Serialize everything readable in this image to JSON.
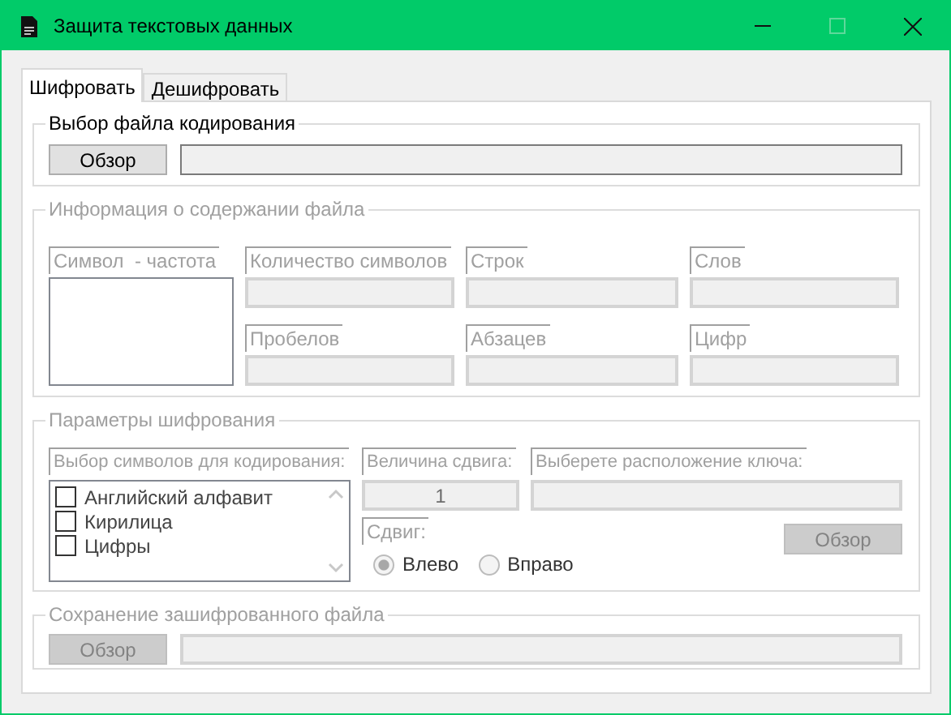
{
  "window": {
    "title": "Защита текстовых данных"
  },
  "tabs": [
    {
      "label": "Шифровать",
      "selected": true
    },
    {
      "label": "Дешифровать",
      "selected": false
    }
  ],
  "file_group": {
    "title": "Выбор файла кодирования",
    "disabled": false,
    "browse_button": "Обзор"
  },
  "info_group": {
    "title": "Информация о содержании файла",
    "disabled": true,
    "frequency_label": "Символ  - частота",
    "stats": [
      {
        "label": "Количество символов"
      },
      {
        "label": "Строк"
      },
      {
        "label": "Слов"
      },
      {
        "label": "Пробелов"
      },
      {
        "label": "Абзацев"
      },
      {
        "label": "Цифр"
      }
    ]
  },
  "params_group": {
    "title": "Параметры шифрования",
    "disabled": true,
    "charset_label": "Выбор символов для кодирования:",
    "charsets": [
      {
        "label": "Английский алфавит",
        "checked": false
      },
      {
        "label": "Кирилица",
        "checked": false
      },
      {
        "label": "Цифры",
        "checked": false
      }
    ],
    "shift_label": "Величина сдвига:",
    "shift_value": "1",
    "key_label": "Выберете расположение ключа:",
    "browse_button": "Обзор",
    "direction_label": "Сдвиг:",
    "directions": [
      {
        "label": "Влево",
        "selected": true
      },
      {
        "label": "Вправо",
        "selected": false
      }
    ]
  },
  "save_group": {
    "title": "Сохранение зашифрованного файла",
    "disabled": true,
    "browse_button": "Обзор"
  }
}
